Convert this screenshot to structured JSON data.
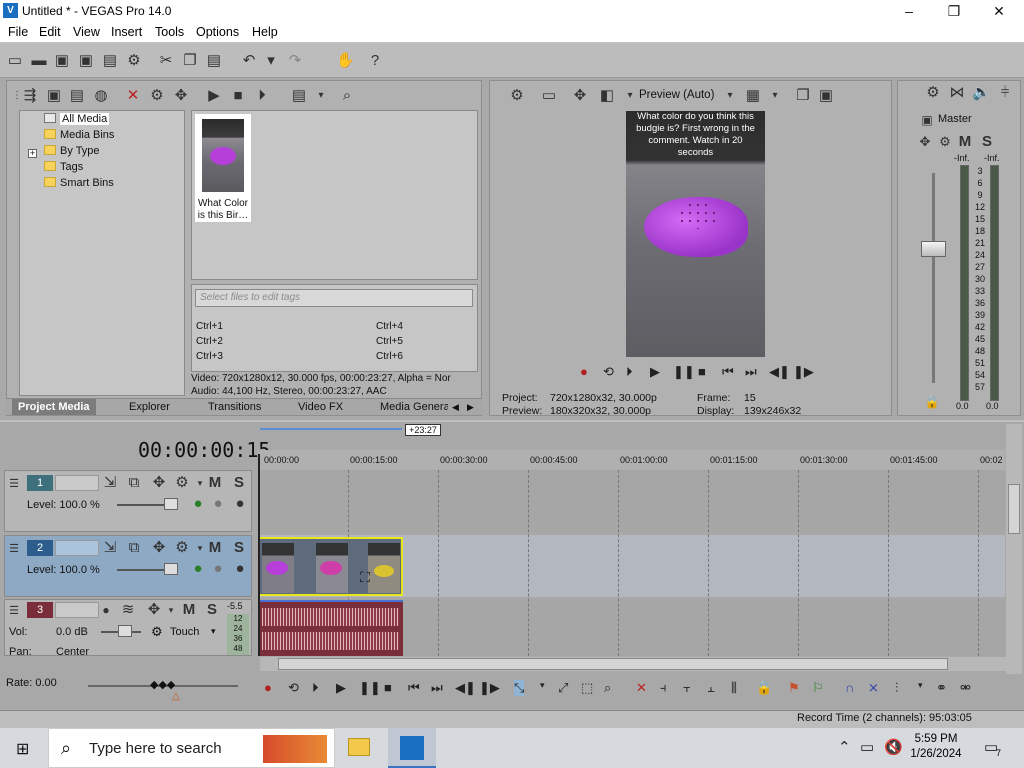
{
  "window": {
    "title": "Untitled * - VEGAS Pro 14.0",
    "logo": "V",
    "minimize": "–",
    "maximize": "❐",
    "close": "✕"
  },
  "menu": [
    "File",
    "Edit",
    "View",
    "Insert",
    "Tools",
    "Options",
    "Help"
  ],
  "media": {
    "tree": [
      "All Media",
      "Media Bins",
      "By Type",
      "Tags",
      "Smart Bins"
    ],
    "tree_plus": "+",
    "thumb_label": "What Color is this Bir…",
    "tag_placeholder": "Select files to edit tags",
    "shortcuts": [
      "Ctrl+1",
      "Ctrl+2",
      "Ctrl+3",
      "Ctrl+4",
      "Ctrl+5",
      "Ctrl+6"
    ],
    "info_video": "Video: 720x1280x12, 30.000 fps, 00:00:23:27, Alpha = Nor",
    "info_audio": "Audio: 44,100 Hz, Stereo, 00:00:23:27, AAC",
    "tabs": [
      "Project Media",
      "Explorer",
      "Transitions",
      "Video FX",
      "Media Generat"
    ]
  },
  "preview": {
    "mode": "Preview (Auto)",
    "overlay_text": "What color do you think this budgie is? First wrong in the comment. Watch in 20 seconds",
    "project_label": "Project:",
    "project_value": "720x1280x32, 30.000p",
    "preview_label": "Preview:",
    "preview_value": "180x320x32, 30.000p",
    "frame_label": "Frame:",
    "frame_value": "15",
    "display_label": "Display:",
    "display_value": "139x246x32"
  },
  "mixer": {
    "master": "Master",
    "m": "M",
    "s": "S",
    "left_peak": "-Inf.",
    "right_peak": "-Inf.",
    "left_value": "0.0",
    "right_value": "0.0",
    "scale": [
      "3",
      "6",
      "9",
      "12",
      "15",
      "18",
      "21",
      "24",
      "27",
      "30",
      "33",
      "36",
      "39",
      "42",
      "45",
      "48",
      "51",
      "54",
      "57"
    ]
  },
  "timeline": {
    "timecode": "00:00:00:15",
    "region": "+23:27",
    "ruler": [
      "00:00:00",
      "00:00:15:00",
      "00:00:30:00",
      "00:00:45:00",
      "00:01:00:00",
      "00:01:15:00",
      "00:01:30:00",
      "00:01:45:00",
      "00:02"
    ],
    "tracks": [
      {
        "num": "1",
        "level": "Level: 100.0 %",
        "m": "M",
        "s": "S"
      },
      {
        "num": "2",
        "level": "Level: 100.0 %",
        "m": "M",
        "s": "S"
      },
      {
        "num": "3",
        "vol": "Vol:",
        "vol_value": "0.0 dB",
        "pan": "Pan:",
        "pan_value": "Center",
        "touch": "Touch",
        "m": "M",
        "s": "S",
        "meter_top": "-5.5",
        "meter_scale": [
          "12",
          "24",
          "36",
          "48"
        ]
      }
    ],
    "rate": "Rate: 0.00"
  },
  "status": {
    "record_time": "Record Time (2 channels): 95:03:05"
  },
  "taskbar": {
    "search_placeholder": "Type here to search",
    "time": "5:59 PM",
    "date": "1/26/2024",
    "notifications": "7"
  }
}
